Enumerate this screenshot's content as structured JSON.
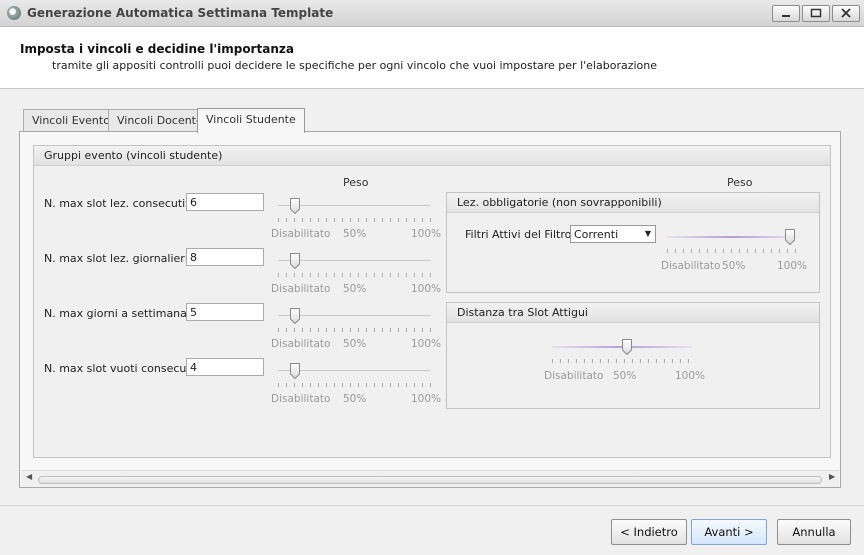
{
  "window": {
    "title": "Generazione Automatica Settimana Template"
  },
  "header": {
    "title": "Imposta i vincoli e decidine l'importanza",
    "subtitle": "tramite gli appositi controlli puoi decidere le specifiche per ogni vincolo che vuoi impostare per l'elaborazione"
  },
  "tabs": [
    {
      "label": "Vincoli Evento",
      "active": false
    },
    {
      "label": "Vincoli Docente",
      "active": false
    },
    {
      "label": "Vincoli Studente",
      "active": true
    }
  ],
  "main_group": {
    "title": "Gruppi evento (vincoli studente)",
    "peso_label": "Peso",
    "scale": {
      "min": "Disabilitato",
      "mid": "50%",
      "max": "100%"
    },
    "rows": [
      {
        "label": "N. max slot lez. consecutivi",
        "value": "6",
        "weight": 0
      },
      {
        "label": "N. max slot lez. giornalieri",
        "value": "8",
        "weight": 0
      },
      {
        "label": "N. max giorni a settimana",
        "value": "5",
        "weight": 0
      },
      {
        "label": "N. max slot vuoti consecutivi",
        "value": "4",
        "weight": 0
      }
    ]
  },
  "right_peso_label": "Peso",
  "lez_group": {
    "title": "Lez. obbligatorie (non sovrapponibili)",
    "filter_label": "Filtri Attivi del Filtro:",
    "filter_value": "Correnti",
    "weight": 1.0
  },
  "distanza_group": {
    "title": "Distanza tra Slot Attigui",
    "weight": 0.5
  },
  "buttons": {
    "back": "< Indietro",
    "next": "Avanti >",
    "cancel": "Annulla"
  },
  "colors": {
    "accent": "#b79cd0",
    "primary_border": "#7ea6d6"
  }
}
